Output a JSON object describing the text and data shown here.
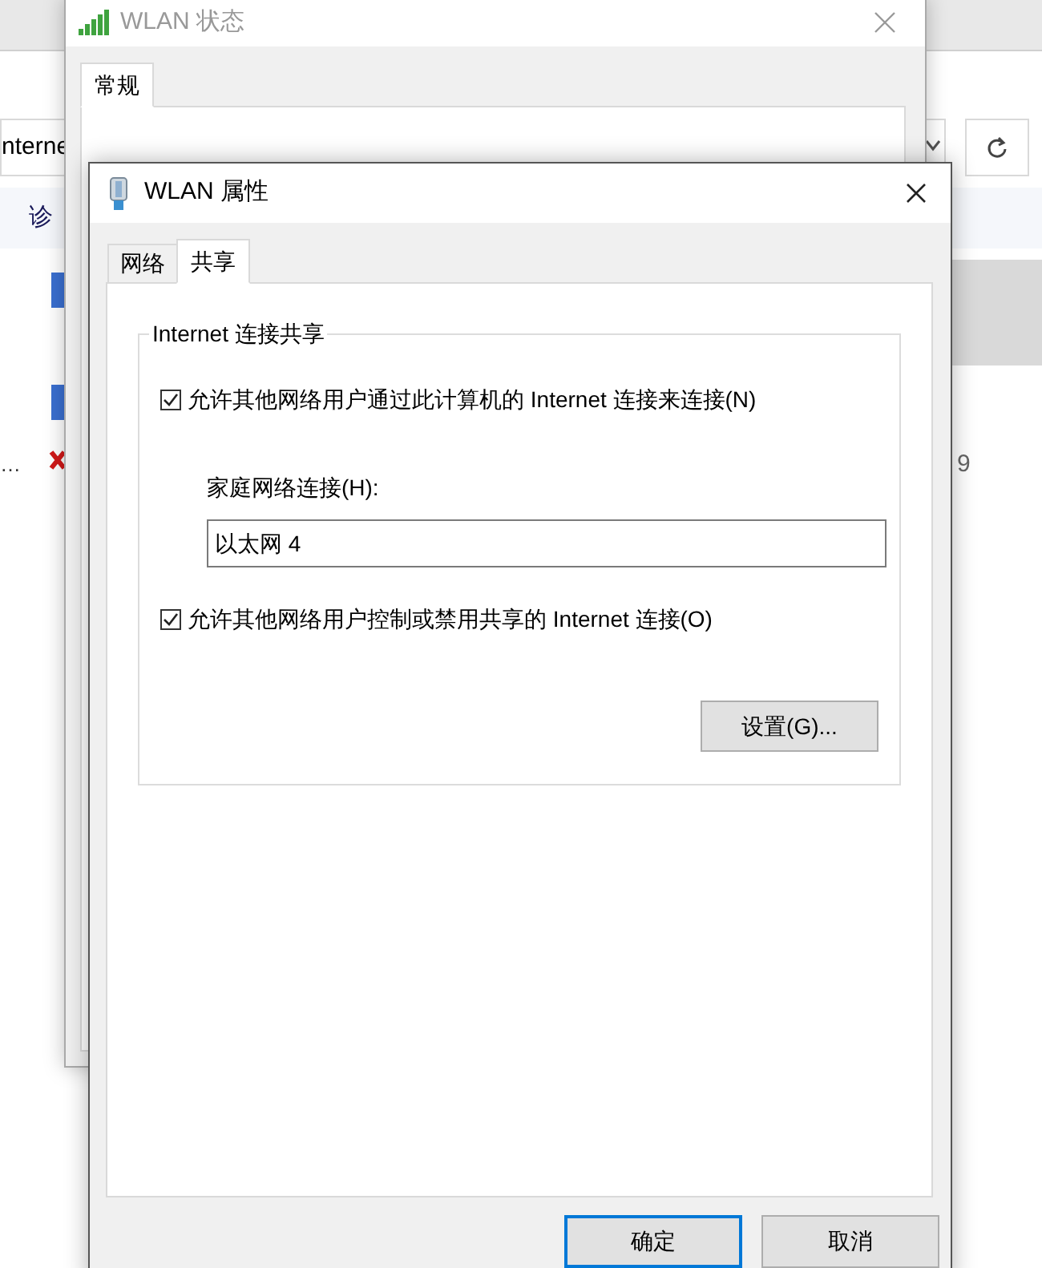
{
  "background_window": {
    "address_text": "nterne",
    "toolbar_text": "诊",
    "list_text_1": "…",
    "list_text_2": "9"
  },
  "status_window": {
    "title": "WLAN 状态",
    "tabs": [
      {
        "label": "常规",
        "selected": true
      }
    ]
  },
  "properties_dialog": {
    "title": "WLAN 属性",
    "tabs": [
      {
        "label": "网络",
        "selected": false
      },
      {
        "label": "共享",
        "selected": true
      }
    ],
    "group": {
      "title": "Internet 连接共享",
      "options": [
        {
          "label": "允许其他网络用户通过此计算机的 Internet 连接来连接(N)",
          "checked": true
        },
        {
          "label": "允许其他网络用户控制或禁用共享的 Internet 连接(O)",
          "checked": true
        }
      ],
      "home_connection": {
        "label": "家庭网络连接(H):",
        "value": "以太网 4"
      },
      "settings_button": "设置(G)..."
    },
    "buttons": [
      {
        "label": "确定",
        "default": true
      },
      {
        "label": "取消",
        "default": false
      }
    ]
  }
}
